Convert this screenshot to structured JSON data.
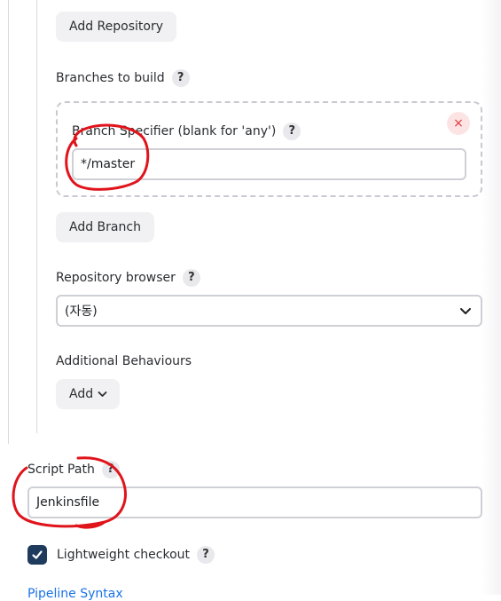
{
  "git": {
    "add_repository": "Add Repository",
    "branches_label": "Branches to build",
    "branch_specifier_label": "Branch Specifier (blank for 'any')",
    "branch_specifier_value": "*/master",
    "remove_symbol": "×",
    "add_branch": "Add Branch",
    "repo_browser_label": "Repository browser",
    "repo_browser_value": "(자동)",
    "additional_behaviours_label": "Additional Behaviours",
    "add_label": "Add"
  },
  "script": {
    "path_label": "Script Path",
    "path_value": "Jenkinsfile",
    "lightweight_label": "Lightweight checkout"
  },
  "footer": {
    "link_text": "Pipeline Syntax"
  },
  "help_symbol": "?",
  "annotation_color": "#e0141b"
}
